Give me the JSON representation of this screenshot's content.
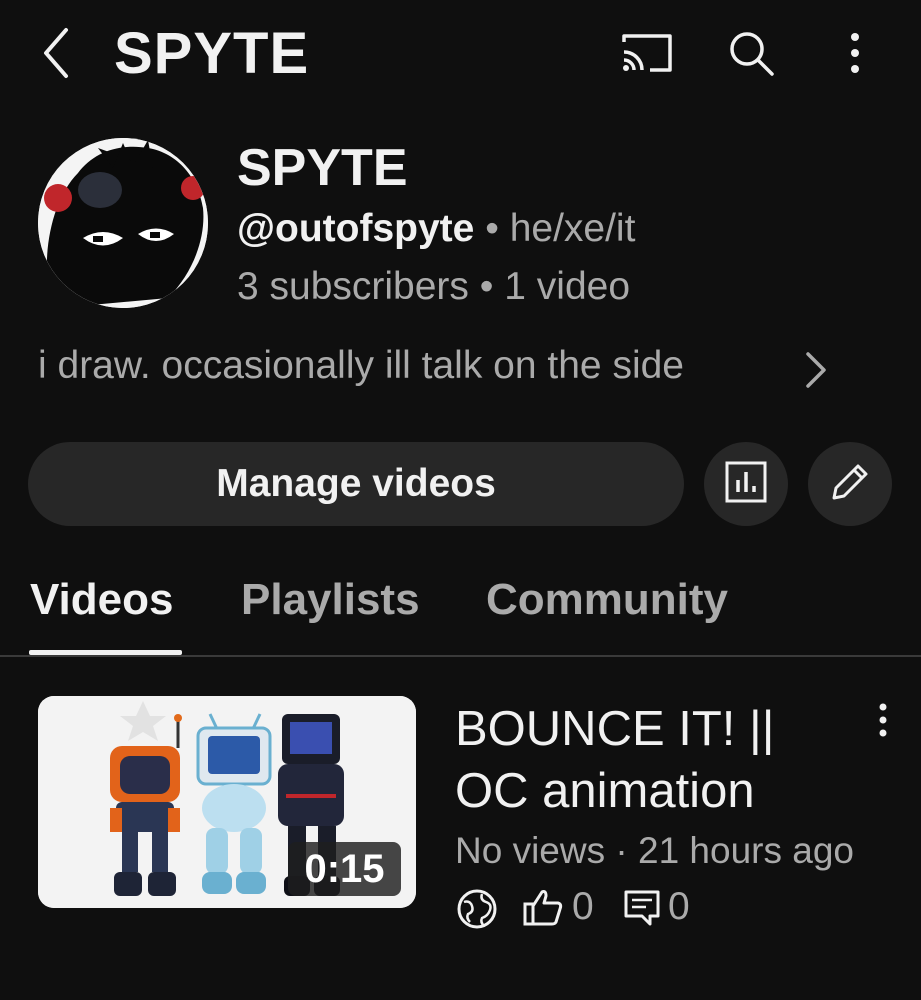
{
  "header": {
    "title": "SPYTE",
    "icons": [
      "back-icon",
      "cast-icon",
      "search-icon",
      "more-vertical-icon"
    ]
  },
  "channel": {
    "name": "SPYTE",
    "handle": "@outofspyte",
    "separator": " • ",
    "pronouns": "he/xe/it",
    "subscribers": "3 subscribers",
    "videos_count": "1 video",
    "description": "i draw. occasionally ill talk on the side"
  },
  "actions": {
    "manage_label": "Manage videos",
    "icons": [
      "analytics-icon",
      "edit-pencil-icon"
    ]
  },
  "tabs": [
    {
      "label": "Videos",
      "active": true
    },
    {
      "label": "Playlists",
      "active": false
    },
    {
      "label": "Community",
      "active": false
    }
  ],
  "video": {
    "title": "BOUNCE IT! || OC animation",
    "duration": "0:15",
    "views": "No views",
    "meta_sep": " · ",
    "age": "21 hours ago",
    "visibility_icon": "globe-icon",
    "likes": "0",
    "comments": "0"
  },
  "colors": {
    "background": "#0f0f0f",
    "surface": "#272727",
    "text_primary": "#f1f1f1",
    "text_secondary": "#aaaaaa"
  }
}
